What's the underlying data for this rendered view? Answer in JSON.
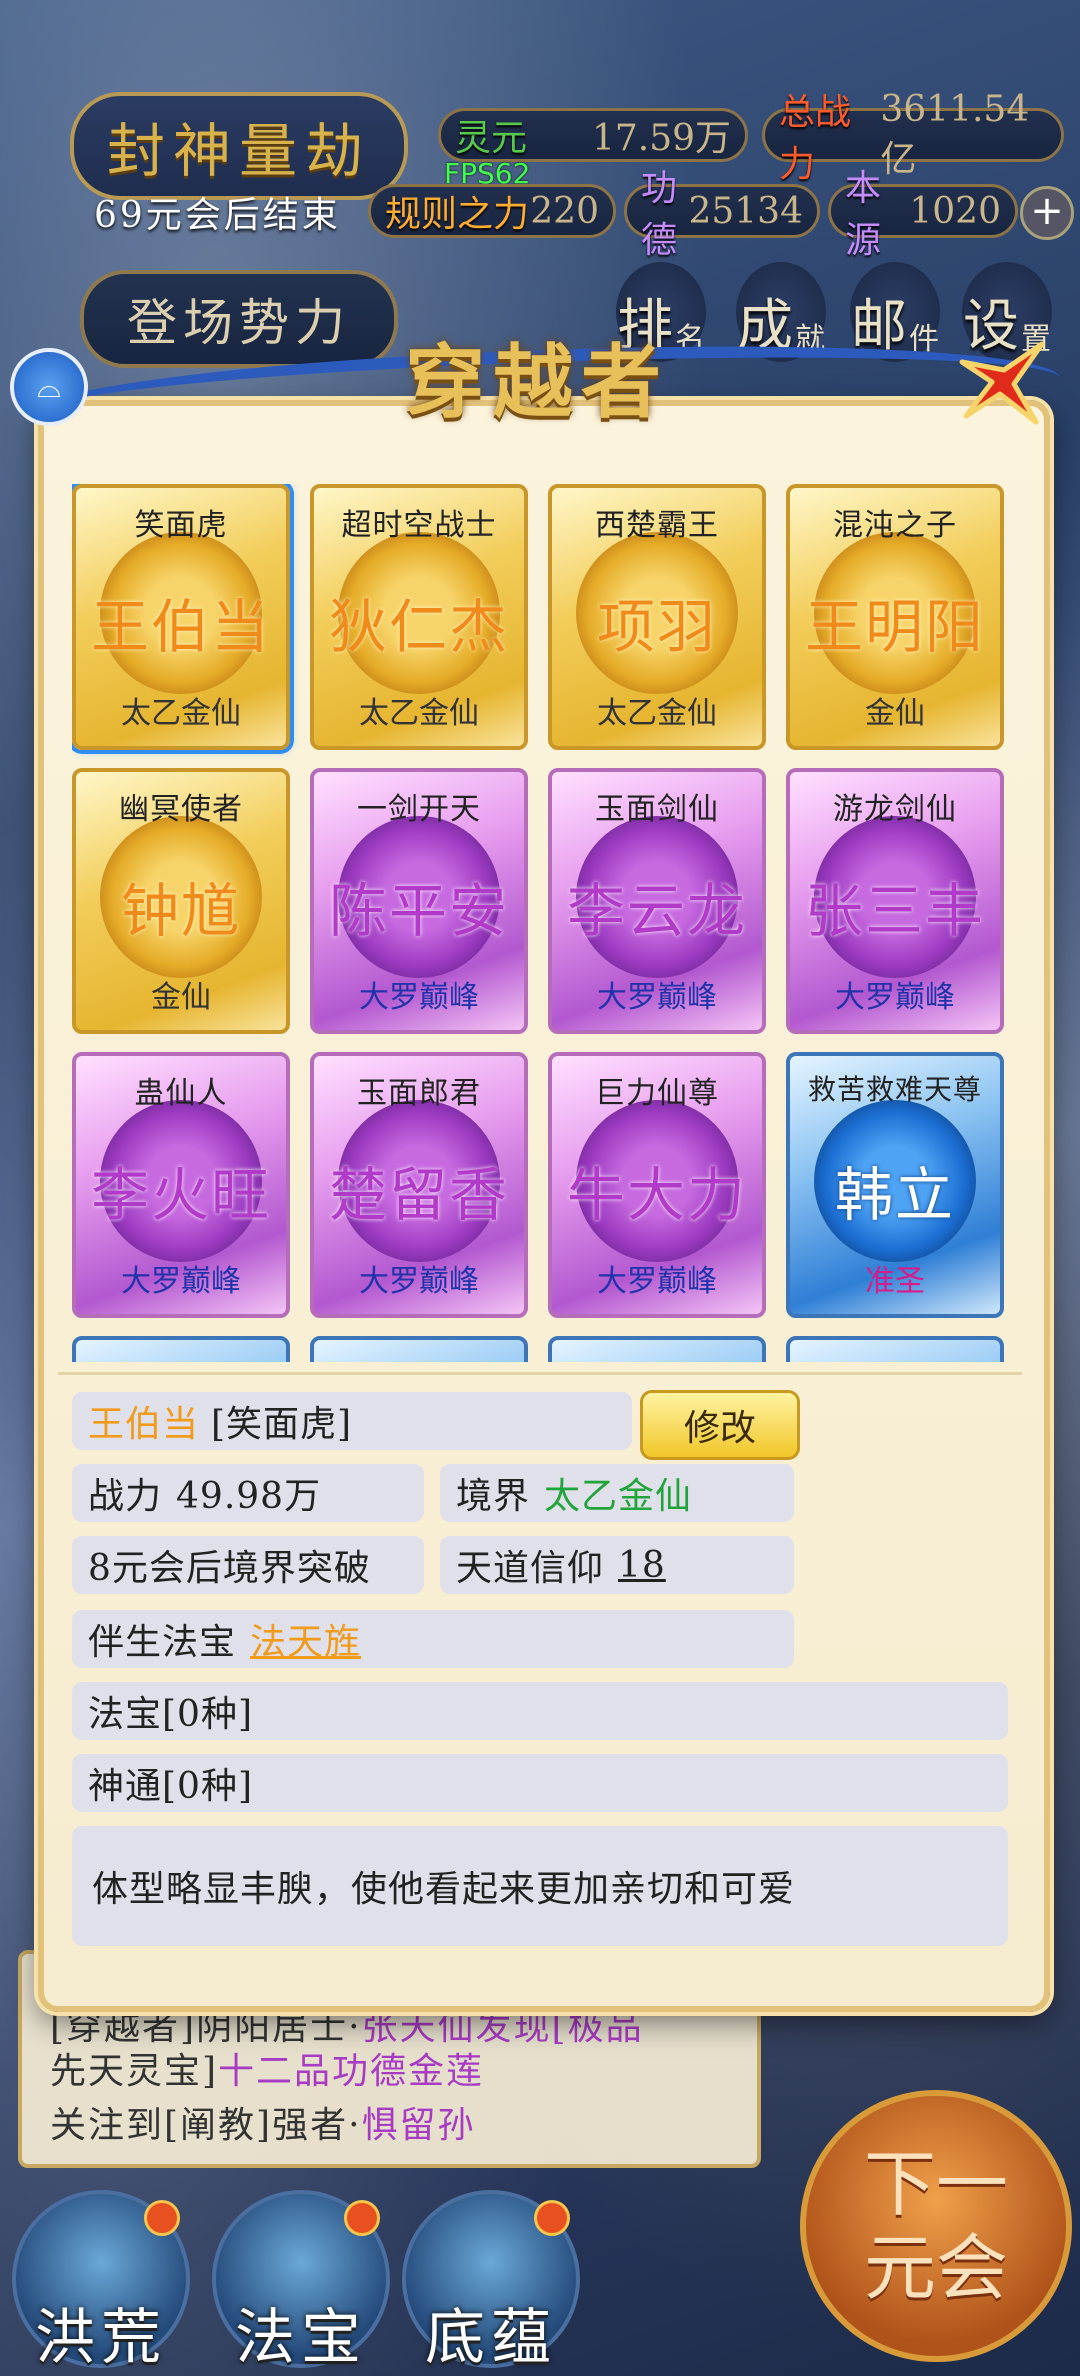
{
  "hud": {
    "game_title": "封神量劫",
    "era_end": "69元会后结束",
    "fps": "FPS62",
    "stats": {
      "lingyuan_label": "灵元",
      "lingyuan_value": "17.59万",
      "power_label": "总战力",
      "power_value": "3611.54亿",
      "rule_label": "规则之力",
      "rule_value": "220",
      "merit_label": "功德",
      "merit_value": "25134",
      "origin_label": "本源",
      "origin_value": "1020"
    },
    "faction_button": "登场势力",
    "top_menu": [
      {
        "big": "排",
        "small": "名"
      },
      {
        "big": "成",
        "small": "就"
      },
      {
        "big": "邮",
        "small": "件"
      },
      {
        "big": "设",
        "small": "置"
      }
    ]
  },
  "modal": {
    "title": "穿越者",
    "cards": [
      {
        "title": "笑面虎",
        "name": "王伯当",
        "realm": "太乙金仙",
        "tier": "gold",
        "selected": true
      },
      {
        "title": "超时空战士",
        "name": "狄仁杰",
        "realm": "太乙金仙",
        "tier": "gold"
      },
      {
        "title": "西楚霸王",
        "name": "项羽",
        "realm": "太乙金仙",
        "tier": "gold"
      },
      {
        "title": "混沌之子",
        "name": "王明阳",
        "realm": "金仙",
        "tier": "gold"
      },
      {
        "title": "幽冥使者",
        "name": "钟馗",
        "realm": "金仙",
        "tier": "gold"
      },
      {
        "title": "一剑开天",
        "name": "陈平安",
        "realm": "大罗巅峰",
        "tier": "purple"
      },
      {
        "title": "玉面剑仙",
        "name": "李云龙",
        "realm": "大罗巅峰",
        "tier": "purple"
      },
      {
        "title": "游龙剑仙",
        "name": "张三丰",
        "realm": "大罗巅峰",
        "tier": "purple"
      },
      {
        "title": "蛊仙人",
        "name": "李火旺",
        "realm": "大罗巅峰",
        "tier": "purple"
      },
      {
        "title": "玉面郎君",
        "name": "楚留香",
        "realm": "大罗巅峰",
        "tier": "purple"
      },
      {
        "title": "巨力仙尊",
        "name": "牛大力",
        "realm": "大罗巅峰",
        "tier": "purple"
      },
      {
        "title": "救苦救难天尊",
        "name": "韩立",
        "realm": "准圣",
        "tier": "blue"
      }
    ],
    "detail": {
      "name": "王伯当",
      "nickname": "[笑面虎]",
      "edit_label": "修改",
      "power_label": "战力",
      "power_value": "49.98万",
      "realm_label": "境界",
      "realm_value": "太乙金仙",
      "breakthrough": "8元会后境界突破",
      "faith_label": "天道信仰",
      "faith_value": "18",
      "companion_label": "伴生法宝",
      "companion_value": "法天旌",
      "treasures": "法宝[0种]",
      "powers": "神通[0种]",
      "description": "体型略显丰腴，使他看起来更加亲切和可爱"
    }
  },
  "news": {
    "line1": "[穿越者]阴阳居士·",
    "line1_purple": "张天仙发现[极品",
    "line2": "先天灵宝]",
    "line2_purple": "十二品功德金莲",
    "line3": "关注到[阐教]强者·",
    "line3_purple": "惧留孙"
  },
  "bottom_nav": [
    "洪荒",
    "法宝",
    "底蕴"
  ],
  "next_button": [
    "下一",
    "元会"
  ],
  "colors": {
    "gold": "#e6b530",
    "purple": "#b358d0",
    "blue": "#2f7fd6",
    "accent_blue": "#2d5bbd"
  }
}
